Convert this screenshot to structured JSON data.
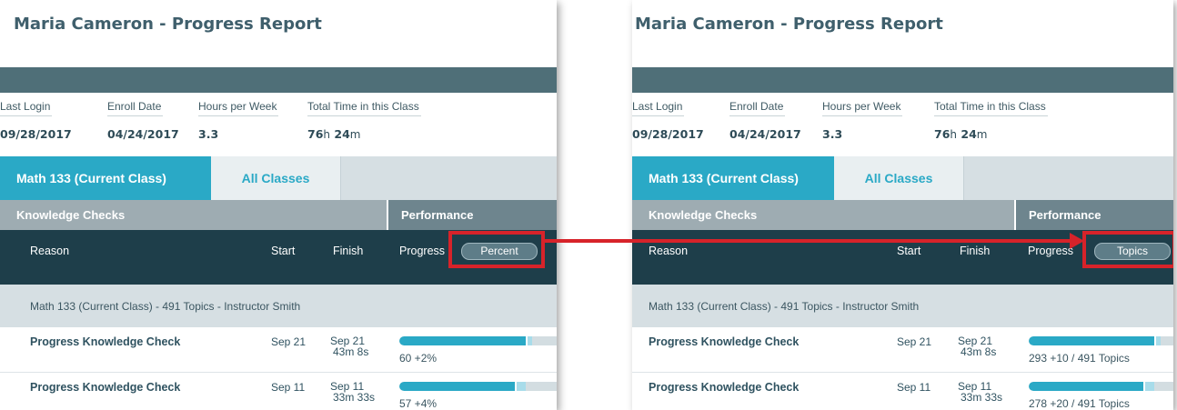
{
  "panels": [
    {
      "title": "Maria Cameron - Progress Report",
      "info": {
        "last_login_label": "Last Login",
        "last_login_value": "09/28/2017",
        "enroll_label": "Enroll Date",
        "enroll_value": "04/24/2017",
        "hours_label": "Hours per Week",
        "hours_value": "3.3",
        "total_label": "Total Time in this Class",
        "total_h": "76",
        "total_h_unit": "h",
        "total_m": "24",
        "total_m_unit": "m"
      },
      "tabs": {
        "current": "Math 133 (Current Class)",
        "all": "All Classes"
      },
      "headers": {
        "knowledge_checks": "Knowledge Checks",
        "performance": "Performance"
      },
      "columns": {
        "reason": "Reason",
        "start": "Start",
        "finish": "Finish",
        "progress": "Progress",
        "toggle": "Percent"
      },
      "group": "Math 133 (Current Class) - 491 Topics - Instructor Smith",
      "rows": [
        {
          "name": "Progress Knowledge Check",
          "start": "Sep 21",
          "finish_date": "Sep 21",
          "finish_time": "43m 8s",
          "progress_text": "60 +2%",
          "progress": 0.6,
          "increment": 0.02
        },
        {
          "name": "Progress Knowledge Check",
          "start": "Sep 11",
          "finish_date": "Sep 11",
          "finish_time": "33m 33s",
          "progress_text": "57 +4%",
          "progress": 0.57,
          "increment": 0.04
        }
      ]
    },
    {
      "title": "Maria Cameron - Progress Report",
      "info": {
        "last_login_label": "Last Login",
        "last_login_value": "09/28/2017",
        "enroll_label": "Enroll Date",
        "enroll_value": "04/24/2017",
        "hours_label": "Hours per Week",
        "hours_value": "3.3",
        "total_label": "Total Time in this Class",
        "total_h": "76",
        "total_h_unit": "h",
        "total_m": "24",
        "total_m_unit": "m"
      },
      "tabs": {
        "current": "Math 133 (Current Class)",
        "all": "All Classes"
      },
      "headers": {
        "knowledge_checks": "Knowledge Checks",
        "performance": "Performance"
      },
      "columns": {
        "reason": "Reason",
        "start": "Start",
        "finish": "Finish",
        "progress": "Progress",
        "toggle": "Topics"
      },
      "group": "Math 133 (Current Class) - 491 Topics - Instructor Smith",
      "rows": [
        {
          "name": "Progress Knowledge Check",
          "start": "Sep 21",
          "finish_date": "Sep 21",
          "finish_time": "43m 8s",
          "progress_text": "293 +10 / 491 Topics",
          "progress": 0.597,
          "increment": 0.02
        },
        {
          "name": "Progress Knowledge Check",
          "start": "Sep 11",
          "finish_date": "Sep 11",
          "finish_time": "33m 33s",
          "progress_text": "278 +20 / 491 Topics",
          "progress": 0.566,
          "increment": 0.041
        }
      ]
    }
  ],
  "colors": {
    "accent": "#2aa9c6",
    "highlight": "#d7232a",
    "dark_header": "#1e3e4a"
  }
}
